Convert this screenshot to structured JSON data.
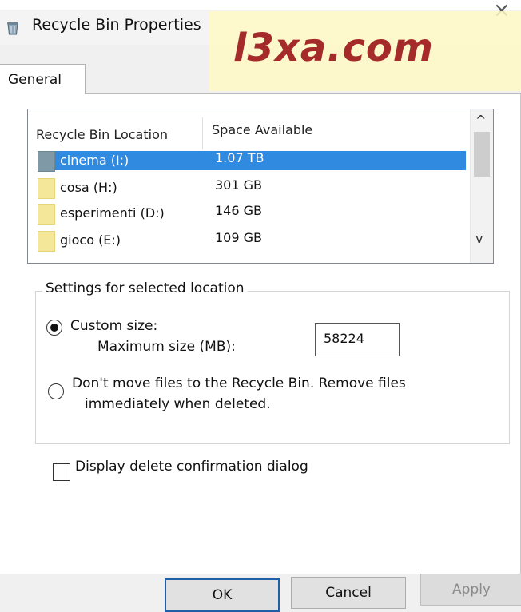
{
  "window": {
    "title": "Recycle Bin Properties",
    "close_glyph": "×",
    "icon": "recycle-bin-icon"
  },
  "watermark": "l3xa.com",
  "tabs": [
    {
      "label": "General",
      "selected": true
    }
  ],
  "list": {
    "columns": [
      "Recycle Bin Location",
      "Space Available"
    ],
    "rows": [
      {
        "name": "cinema (I:)",
        "space": "1.07 TB",
        "selected": true
      },
      {
        "name": "cosa (H:)",
        "space": "301 GB",
        "selected": false
      },
      {
        "name": "esperimenti (D:)",
        "space": "146 GB",
        "selected": false
      },
      {
        "name": "gioco (E:)",
        "space": "109 GB",
        "selected": false
      }
    ],
    "scroll_up_glyph": "^",
    "scroll_down_glyph": "v"
  },
  "settings": {
    "legend": "Settings for selected location",
    "custom_size_label": "Custom size:",
    "max_size_label": "Maximum size (MB):",
    "max_size_value": "58224",
    "custom_size_selected": true,
    "dont_move_line1": "Don't move files to the Recycle Bin. Remove files",
    "dont_move_line2": "immediately when deleted.",
    "dont_move_selected": false
  },
  "confirm": {
    "label": "Display delete confirmation dialog",
    "checked": false
  },
  "buttons": {
    "ok": "OK",
    "cancel": "Cancel",
    "apply": "Apply"
  },
  "colors": {
    "selection": "#2f8ae0",
    "folder": "#f5e79a",
    "watermark_text": "#a52a2a",
    "watermark_bg": "#fff9c4"
  }
}
